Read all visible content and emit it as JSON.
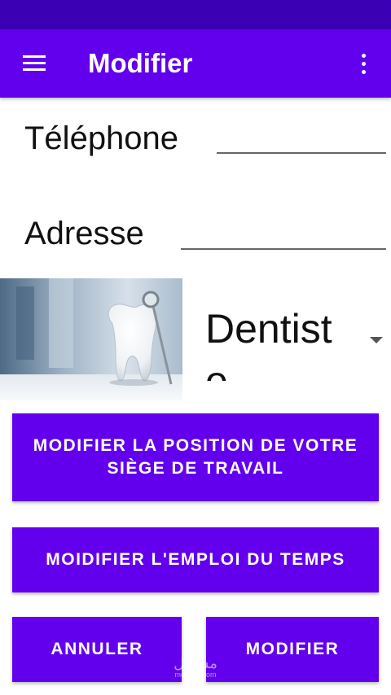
{
  "app_bar": {
    "title": "Modifier",
    "menu_icon": "hamburger-menu-icon",
    "more_icon": "more-vert-icon"
  },
  "colors": {
    "status_bar": "#3c00b4",
    "primary": "#6200ee",
    "on_primary": "#ffffff"
  },
  "form": {
    "telephone_label": "Téléphone",
    "telephone_value": "",
    "adresse_label": "Adresse",
    "adresse_value": "",
    "specialty_selected": "Dentiste",
    "specialty_image": "dentist-tooth-mirror-photo"
  },
  "buttons": {
    "position": "MODIFIER LA POSITION DE VOTRE SIÈGE DE TRAVAIL",
    "schedule": "MOIDIFIER L'EMPLOI DU TEMPS",
    "cancel": "ANNULER",
    "modify": "MODIFIER"
  },
  "watermark": {
    "text": "مستقل",
    "sub": "mostaql.com"
  }
}
